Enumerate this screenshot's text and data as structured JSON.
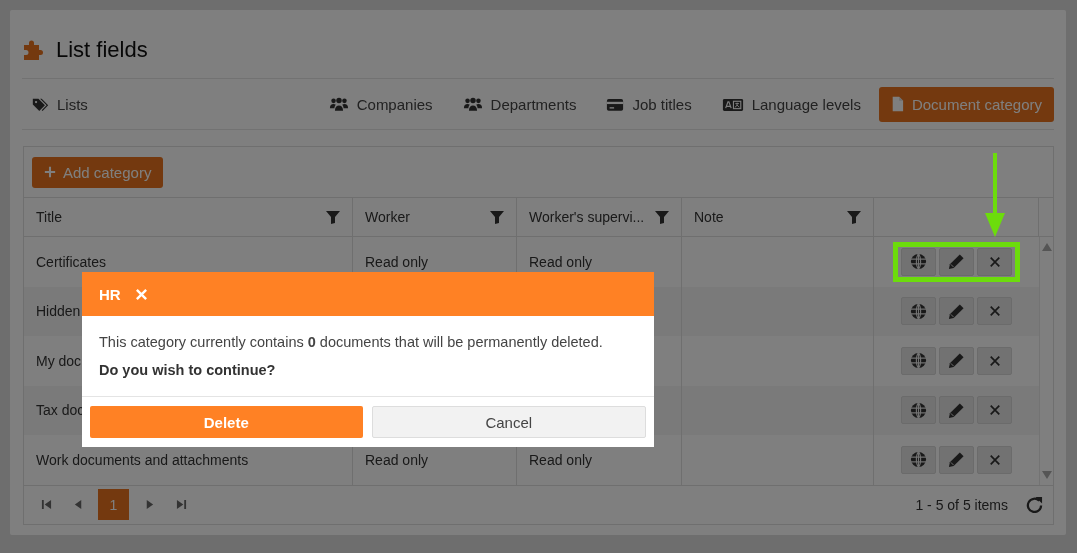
{
  "page": {
    "title": "List fields"
  },
  "nav": {
    "lists_label": "Lists",
    "tabs": [
      {
        "label": "Companies",
        "selected": false
      },
      {
        "label": "Departments",
        "selected": false
      },
      {
        "label": "Job titles",
        "selected": false
      },
      {
        "label": "Language levels",
        "selected": false
      },
      {
        "label": "Document category",
        "selected": true
      }
    ]
  },
  "grid": {
    "add_button": "Add category",
    "columns": [
      {
        "label": "Title"
      },
      {
        "label": "Worker"
      },
      {
        "label": "Worker's supervi..."
      },
      {
        "label": "Note"
      }
    ],
    "rows": [
      {
        "title": "Certificates",
        "worker": "Read only",
        "supervisor": "Read only",
        "highlighted": true
      },
      {
        "title": "Hidden",
        "highlighted": false
      },
      {
        "title": "My doc",
        "highlighted": false
      },
      {
        "title": "Tax doc",
        "highlighted": false
      },
      {
        "title": "Work documents and attachments",
        "worker": "Read only",
        "supervisor": "Read only",
        "highlighted": false
      }
    ],
    "pages": [
      {
        "label": "1",
        "selected": true
      }
    ],
    "summary": "1 - 5 of 5 items"
  },
  "dialog": {
    "title": "HR",
    "message": "This category currently contains **0** documents that will be permanently deleted.",
    "question": "Do you wish to continue?",
    "buttons": [
      {
        "label": "Delete",
        "kind": "primary"
      },
      {
        "label": "Cancel",
        "kind": "secondary"
      }
    ]
  }
}
